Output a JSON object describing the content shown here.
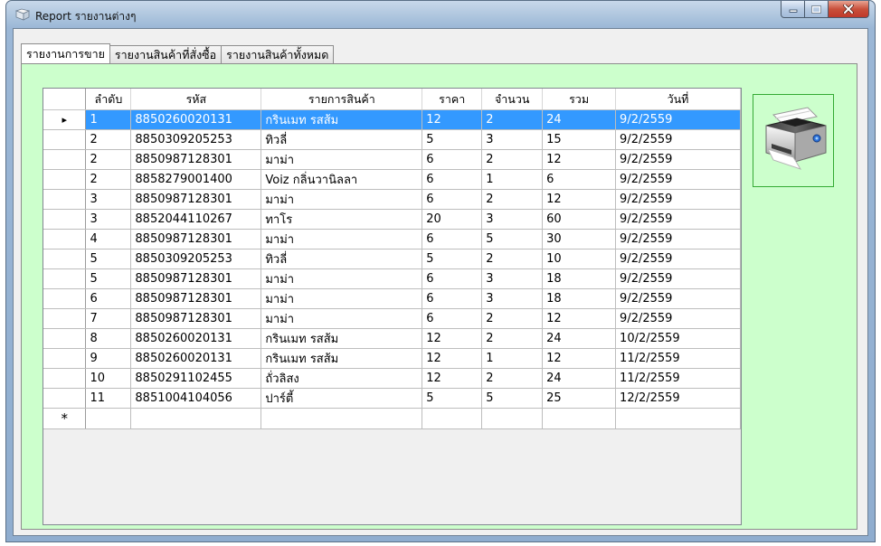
{
  "window": {
    "title": "Report รายงานต่างๆ"
  },
  "tabs": [
    {
      "label": "รายงานการขาย",
      "active": true
    },
    {
      "label": "รายงานสินค้าที่สั่งซื้อ",
      "active": false
    },
    {
      "label": "รายงานสินค้าทั้งหมด",
      "active": false
    }
  ],
  "grid": {
    "columns": [
      "ลำดับ",
      "รหัส",
      "รายการสินค้า",
      "ราคา",
      "จำนวน",
      "รวม",
      "วันที่"
    ],
    "rows": [
      [
        "1",
        "8850260020131",
        "กรินเมท รสส้ม",
        "12",
        "2",
        "24",
        "9/2/2559"
      ],
      [
        "2",
        "8850309205253",
        "ทิวลี่",
        "5",
        "3",
        "15",
        "9/2/2559"
      ],
      [
        "2",
        "8850987128301",
        "มาม่า",
        "6",
        "2",
        "12",
        "9/2/2559"
      ],
      [
        "2",
        "8858279001400",
        "Voiz กลิ่นวานิลลา",
        "6",
        "1",
        "6",
        "9/2/2559"
      ],
      [
        "3",
        "8850987128301",
        "มาม่า",
        "6",
        "2",
        "12",
        "9/2/2559"
      ],
      [
        "3",
        "8852044110267",
        "ทาโร",
        "20",
        "3",
        "60",
        "9/2/2559"
      ],
      [
        "4",
        "8850987128301",
        "มาม่า",
        "6",
        "5",
        "30",
        "9/2/2559"
      ],
      [
        "5",
        "8850309205253",
        "ทิวลี่",
        "5",
        "2",
        "10",
        "9/2/2559"
      ],
      [
        "5",
        "8850987128301",
        "มาม่า",
        "6",
        "3",
        "18",
        "9/2/2559"
      ],
      [
        "6",
        "8850987128301",
        "มาม่า",
        "6",
        "3",
        "18",
        "9/2/2559"
      ],
      [
        "7",
        "8850987128301",
        "มาม่า",
        "6",
        "2",
        "12",
        "9/2/2559"
      ],
      [
        "8",
        "8850260020131",
        "กรินเมท รสส้ม",
        "12",
        "2",
        "24",
        "10/2/2559"
      ],
      [
        "9",
        "8850260020131",
        "กรินเมท รสส้ม",
        "12",
        "1",
        "12",
        "11/2/2559"
      ],
      [
        "10",
        "8850291102455",
        "ถั่วลิสง",
        "12",
        "2",
        "24",
        "11/2/2559"
      ],
      [
        "11",
        "8851004104056",
        "ปาร์ตี้",
        "5",
        "5",
        "25",
        "12/2/2559"
      ]
    ],
    "selected_row": 0,
    "current_row_marker": "▸",
    "new_row_marker": "*"
  },
  "print_button": {
    "icon": "printer-icon"
  },
  "colors": {
    "tab_page_bg": "#ccffcc",
    "selection": "#3399ff",
    "print_border": "#33aa33"
  }
}
